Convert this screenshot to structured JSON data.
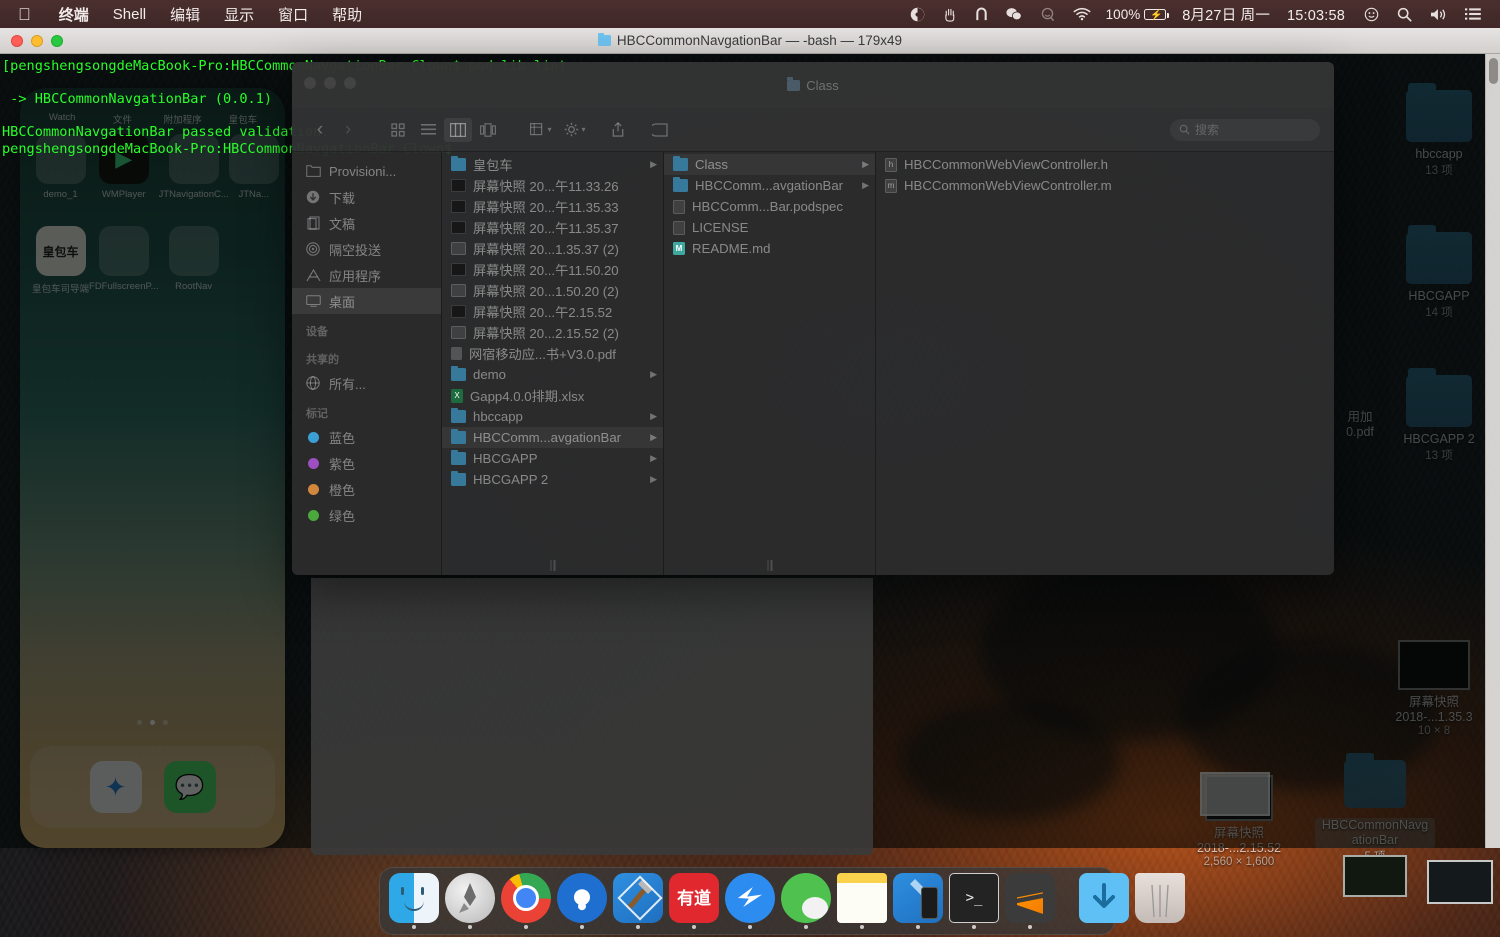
{
  "menubar": {
    "apple_icon": "apple-logo",
    "items": [
      {
        "label": "终端",
        "bold": true
      },
      {
        "label": "Shell",
        "bold": false
      },
      {
        "label": "编辑",
        "bold": false
      },
      {
        "label": "显示",
        "bold": false
      },
      {
        "label": "窗口",
        "bold": false
      },
      {
        "label": "帮助",
        "bold": false
      }
    ],
    "status_icons": [
      {
        "name": "shadowsocks-icon",
        "glyph": "◗"
      },
      {
        "name": "hand-icon",
        "glyph": "✋"
      },
      {
        "name": "magnet-icon",
        "glyph": "⊓"
      },
      {
        "name": "wechat-icon",
        "glyph": "◍"
      },
      {
        "name": "alfred-icon",
        "glyph": "◍"
      },
      {
        "name": "wifi-icon",
        "glyph": "◈"
      }
    ],
    "battery_percent": "100%",
    "battery_icon": "battery-charging-icon",
    "date": "8月27日 周一",
    "time": "15:03:58",
    "siri_icon": "siri-icon",
    "spotlight_icon": "search-icon",
    "volume_icon": "volume-icon",
    "notification_icon": "notification-center-icon"
  },
  "terminal": {
    "title": "HBCCommonNavgationBar — -bash — 179x49",
    "title_folder_icon": "folder-icon",
    "traffic_lights": [
      "close",
      "minimize",
      "zoom"
    ],
    "lines": [
      "[pengshengsongdeMacBook-Pro:HBCCommonNavgationBar Clown$ pod lib lint",
      "",
      " -> HBCCommonNavgationBar (0.0.1)",
      "",
      "HBCCommonNavgationBar passed validation.",
      "pengshengsongdeMacBook-Pro:HBCCommonNavgationBar Clown$"
    ]
  },
  "finder": {
    "title": "Class",
    "title_icon": "folder-icon",
    "toolbar": {
      "back_icon": "chevron-left-icon",
      "forward_icon": "chevron-right-icon",
      "icon_view": "icon-view-icon",
      "list_view": "list-view-icon",
      "column_view": "column-view-icon",
      "gallery_view": "gallery-view-icon",
      "arrange_label": "arrange-icon",
      "action_label": "gear-icon",
      "share_label": "share-icon",
      "tags_label": "tag-icon",
      "search_placeholder": "搜索",
      "search_icon": "search-icon"
    },
    "sidebar": {
      "favorites": [
        {
          "label": "Provisioni...",
          "icon": "folder-icon",
          "selected": false
        },
        {
          "label": "下载",
          "icon": "download-icon",
          "selected": false
        },
        {
          "label": "文稿",
          "icon": "documents-icon",
          "selected": false
        },
        {
          "label": "隔空投送",
          "icon": "airdrop-icon",
          "selected": false
        },
        {
          "label": "应用程序",
          "icon": "applications-icon",
          "selected": false
        },
        {
          "label": "桌面",
          "icon": "desktop-icon",
          "selected": true
        }
      ],
      "devices_header": "设备",
      "shared_header": "共享的",
      "shared": [
        {
          "label": "所有...",
          "icon": "network-icon"
        }
      ],
      "tags_header": "标记",
      "tags": [
        {
          "label": "蓝色",
          "color": "#3b9fd6"
        },
        {
          "label": "紫色",
          "color": "#9b4fc0"
        },
        {
          "label": "橙色",
          "color": "#d2873c"
        },
        {
          "label": "绿色",
          "color": "#4aa83c"
        }
      ]
    },
    "column1": [
      {
        "name": "皇包车",
        "icon": "folder",
        "arrow": true,
        "selected": false
      },
      {
        "name": "屏幕快照 20...午11.33.26",
        "icon": "img",
        "arrow": false,
        "selected": false
      },
      {
        "name": "屏幕快照 20...午11.35.33",
        "icon": "img",
        "arrow": false,
        "selected": false
      },
      {
        "name": "屏幕快照 20...午11.35.37",
        "icon": "img",
        "arrow": false,
        "selected": false
      },
      {
        "name": "屏幕快照 20...1.35.37 (2)",
        "icon": "img-light",
        "arrow": false,
        "selected": false
      },
      {
        "name": "屏幕快照 20...午11.50.20",
        "icon": "img",
        "arrow": false,
        "selected": false
      },
      {
        "name": "屏幕快照 20...1.50.20 (2)",
        "icon": "img-light",
        "arrow": false,
        "selected": false
      },
      {
        "name": "屏幕快照 20...午2.15.52",
        "icon": "img",
        "arrow": false,
        "selected": false
      },
      {
        "name": "屏幕快照 20...2.15.52 (2)",
        "icon": "img-light",
        "arrow": false,
        "selected": false
      },
      {
        "name": "网宿移动应...书+V3.0.pdf",
        "icon": "pdf",
        "arrow": false,
        "selected": false
      },
      {
        "name": "demo",
        "icon": "folder",
        "arrow": true,
        "selected": false
      },
      {
        "name": "Gapp4.0.0排期.xlsx",
        "icon": "xls",
        "arrow": false,
        "selected": false
      },
      {
        "name": "hbccapp",
        "icon": "folder",
        "arrow": true,
        "selected": false
      },
      {
        "name": "HBCComm...avgationBar",
        "icon": "folder",
        "arrow": true,
        "selected": true
      },
      {
        "name": "HBCGAPP",
        "icon": "folder",
        "arrow": true,
        "selected": false
      },
      {
        "name": "HBCGAPP 2",
        "icon": "folder",
        "arrow": true,
        "selected": false
      }
    ],
    "column2": [
      {
        "name": "Class",
        "icon": "folder",
        "arrow": true,
        "selected": true
      },
      {
        "name": "HBCComm...avgationBar",
        "icon": "folder",
        "arrow": true,
        "selected": false
      },
      {
        "name": "HBCComm...Bar.podspec",
        "icon": "doc",
        "arrow": false,
        "selected": false
      },
      {
        "name": "LICENSE",
        "icon": "doc",
        "arrow": false,
        "selected": false
      },
      {
        "name": "README.md",
        "icon": "md",
        "arrow": false,
        "selected": false
      }
    ],
    "column3": [
      {
        "name": "HBCCommonWebViewController.h",
        "icon": "h",
        "arrow": false,
        "selected": false
      },
      {
        "name": "HBCCommonWebViewController.m",
        "icon": "m",
        "arrow": false,
        "selected": false
      }
    ]
  },
  "phone_screenshot": {
    "row_labels": [
      "Watch",
      "文件",
      "附加程序",
      "皇包车"
    ],
    "apps": [
      {
        "label": "demo_1"
      },
      {
        "label": "WMPlayer"
      },
      {
        "label": "JTNavigationC..."
      },
      {
        "label": "JTNa..."
      },
      {
        "label": "皇包车司导端"
      },
      {
        "label": "FDFullscreenP..."
      },
      {
        "label": "RootNav"
      },
      {
        "label": ""
      }
    ],
    "featured_app_label": "皇包车"
  },
  "desktop_icons": [
    {
      "name": "hbccapp",
      "count": "13 项",
      "type": "folder"
    },
    {
      "name": "HBCGAPP",
      "count": "14 项",
      "type": "folder"
    },
    {
      "name": "HBCGAPP 2",
      "count": "13 项",
      "type": "folder"
    },
    {
      "name": "屏幕快照\n2018-...1.35.3",
      "count": "10 × 8",
      "type": "image"
    },
    {
      "name": "屏幕快照\n2018-...2.15.52",
      "count": "2,560 × 1,600",
      "type": "image"
    },
    {
      "name": "HBCCommonNavgationBar",
      "count": "5 项",
      "type": "folder"
    },
    {
      "name": "用加\n0.pdf",
      "count": "",
      "type": "pdf"
    }
  ],
  "dock": {
    "items": [
      {
        "label": "访达",
        "icon": "finder-icon",
        "running": true
      },
      {
        "label": "启动台",
        "icon": "launchpad-icon",
        "running": true
      },
      {
        "label": "Google Chrome",
        "icon": "chrome-icon",
        "running": true
      },
      {
        "label": "Sourcetree",
        "icon": "sourcetree-icon",
        "running": true
      },
      {
        "label": "Xcode",
        "icon": "xcode-icon",
        "running": true
      },
      {
        "label": "有道",
        "icon": "youdao-icon",
        "running": true
      },
      {
        "label": "钉钉",
        "icon": "dingtalk-icon",
        "running": true
      },
      {
        "label": "微信",
        "icon": "wechat-icon",
        "running": true
      },
      {
        "label": "备忘录",
        "icon": "notes-icon",
        "running": true
      },
      {
        "label": "模拟器",
        "icon": "simulator-icon",
        "running": true
      },
      {
        "label": "终端",
        "icon": "terminal-icon",
        "running": true
      },
      {
        "label": "Sublime Text",
        "icon": "sublime-icon",
        "running": true
      }
    ],
    "right_items": [
      {
        "label": "下载",
        "icon": "downloads-folder-icon"
      },
      {
        "label": "废纸篓",
        "icon": "trash-icon"
      }
    ],
    "terminal_glyph": ">_"
  },
  "colors": {
    "menubar_bg": "#43292a",
    "terminal_text": "#2afd2a",
    "finder_bg": "#2f2f30",
    "folder_blue": "#37799b",
    "accent": "#3b9fd6"
  }
}
